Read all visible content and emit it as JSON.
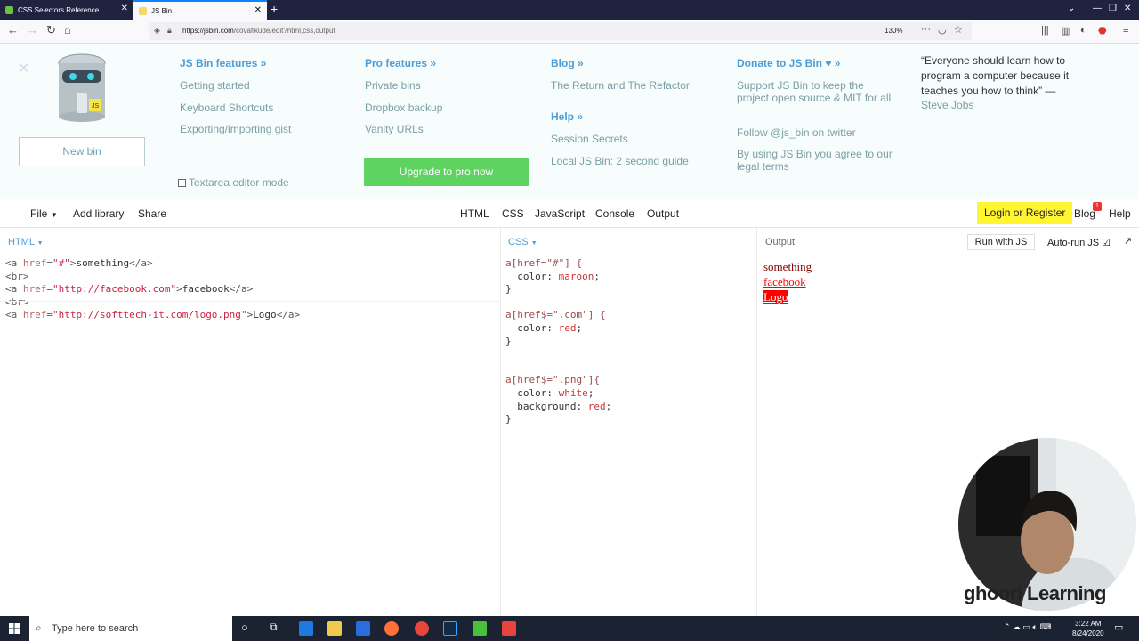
{
  "browser": {
    "tabs": [
      {
        "title": "CSS Selectors Reference"
      },
      {
        "title": "JS Bin"
      }
    ],
    "url_host": "https://jsbin.com",
    "url_path": "/covafikude/edit?html,css,output",
    "zoom": "130%"
  },
  "jsbin_header": {
    "new_bin": "New bin",
    "textarea_mode": "Textarea editor mode",
    "upgrade": "Upgrade to pro now",
    "features": {
      "title": "JS Bin features »",
      "links": [
        "Getting started",
        "Keyboard Shortcuts",
        "Exporting/importing gist"
      ]
    },
    "pro": {
      "title": "Pro features »",
      "links": [
        "Private bins",
        "Dropbox backup",
        "Vanity URLs"
      ]
    },
    "blog": {
      "title": "Blog »",
      "links": [
        "The Return and The Refactor"
      ]
    },
    "help": {
      "title": "Help »",
      "links": [
        "Session Secrets",
        "Local JS Bin: 2 second guide"
      ]
    },
    "donate": {
      "title": "Donate to JS Bin ♥ »",
      "links": [
        "Support JS Bin to keep the project open source & MIT for all",
        "Follow @js_bin on twitter",
        "By using JS Bin you agree to our legal terms"
      ]
    },
    "quote": "“Everyone should learn how to program a computer because it teaches you how to think” —",
    "quote_author": "Steve Jobs"
  },
  "toolbar": {
    "file": "File",
    "add_library": "Add library",
    "share": "Share",
    "panels": [
      "HTML",
      "CSS",
      "JavaScript",
      "Console",
      "Output"
    ],
    "login": "Login or Register",
    "blog": "Blog",
    "blog_badge": "1",
    "help": "Help"
  },
  "html_panel": {
    "label": "HTML",
    "lines": [
      {
        "href": "#",
        "text": "something"
      },
      {
        "href": "http://facebook.com",
        "text": "facebook"
      },
      {
        "href": "http://softtech-it.com/logo.png",
        "text": "Logo"
      }
    ]
  },
  "css_panel": {
    "label": "CSS",
    "rules": [
      {
        "selector": "a[href=\"#\"] {",
        "decls": [
          {
            "prop": "color",
            "val": "maroon"
          }
        ]
      },
      {
        "selector": "a[href$=\".com\"] {",
        "decls": [
          {
            "prop": "color",
            "val": "red"
          }
        ]
      },
      {
        "selector": "a[href$=\".png\"]{",
        "decls": [
          {
            "prop": "color",
            "val": "white"
          },
          {
            "prop": "background",
            "val": "red"
          }
        ]
      }
    ]
  },
  "output_panel": {
    "label": "Output",
    "run_with_js": "Run with JS",
    "auto_run": "Auto-run JS",
    "links": [
      {
        "text": "something",
        "color": "#800000",
        "bg": ""
      },
      {
        "text": "facebook",
        "color": "#ff0000",
        "bg": ""
      },
      {
        "text": "Logo",
        "color": "#ffffff",
        "bg": "#ff0000"
      }
    ]
  },
  "overlay": {
    "brand": "ghoori Learning"
  },
  "taskbar": {
    "search_placeholder": "Type here to search",
    "time": "3:22 AM",
    "date": "8/24/2020"
  }
}
